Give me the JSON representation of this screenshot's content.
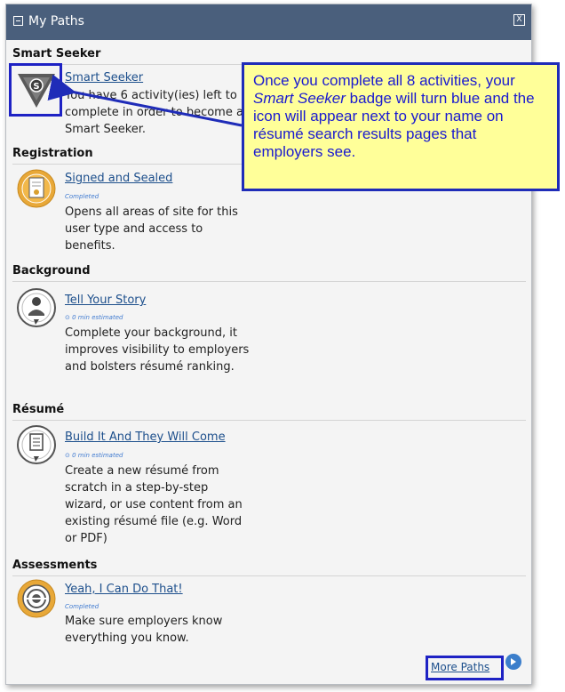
{
  "panel": {
    "title": "My Paths",
    "close_glyph": "X"
  },
  "sections": [
    {
      "heading": "Smart Seeker",
      "link": "Smart Seeker",
      "status": "",
      "desc": "You have 6 activity(ies) left to complete in order to become a Smart Seeker.",
      "icon": "smart-seeker-badge-icon"
    },
    {
      "heading": "Registration",
      "link": "Signed and Sealed",
      "status": "Completed",
      "desc": "Opens all areas of site for this user type and access to benefits.",
      "icon": "certificate-badge-icon"
    },
    {
      "heading": "Background",
      "link": "Tell Your Story",
      "status": "0 min estimated",
      "desc": "Complete your background, it improves visibility to employers and bolsters résumé ranking.",
      "icon": "person-badge-icon"
    },
    {
      "heading": "Résumé",
      "link": "Build It And They Will Come",
      "status": "0 min estimated",
      "desc": "Create a new résumé from scratch in a step-by-step wizard, or use content from an existing résumé file (e.g. Word or PDF)",
      "icon": "document-badge-icon"
    },
    {
      "heading": "Assessments",
      "link": "Yeah, I Can Do That!",
      "status": "Completed",
      "desc": "Make sure employers know everything you know.",
      "icon": "target-badge-icon"
    }
  ],
  "more_paths": "More Paths",
  "callout": {
    "part1": "Once you complete all 8 activities, your ",
    "italic": "Smart Seeker",
    "part2": " badge will turn blue and the icon will appear next to your name on résumé search results pages that employers see."
  },
  "colors": {
    "titlebar": "#4a5f7c",
    "link": "#1d4f8c",
    "callout_bg": "#ffff99",
    "callout_text": "#1a1ad0",
    "highlight": "#1e22c4",
    "gold": "#e8a838"
  }
}
